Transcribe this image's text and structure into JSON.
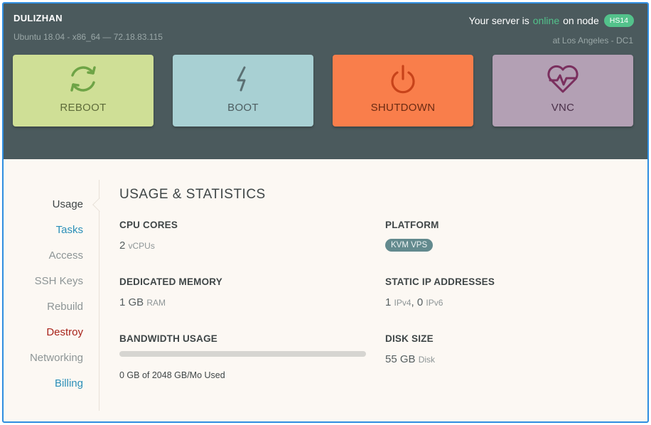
{
  "header": {
    "hostname": "DULIZHAN",
    "sysinfo": "Ubuntu 18.04 - x86_64 — 72.18.83.115",
    "status_prefix": "Your server is",
    "status_word": "online",
    "status_suffix": "on node",
    "node": "HS14",
    "location": "at Los Angeles - DC1"
  },
  "actions": {
    "reboot": {
      "label": "REBOOT",
      "icon": "refresh-icon",
      "color": "#cfdf96"
    },
    "boot": {
      "label": "BOOT",
      "icon": "lightning-icon",
      "color": "#a8d0d3"
    },
    "shutdown": {
      "label": "SHUTDOWN",
      "icon": "power-icon",
      "color": "#f97e4b"
    },
    "vnc": {
      "label": "VNC",
      "icon": "heartbeat-icon",
      "color": "#b3a0b4"
    }
  },
  "sidebar": {
    "items": [
      {
        "label": "Usage",
        "active": true
      },
      {
        "label": "Tasks"
      },
      {
        "label": "Access"
      },
      {
        "label": "SSH Keys"
      },
      {
        "label": "Rebuild"
      },
      {
        "label": "Destroy"
      },
      {
        "label": "Networking"
      },
      {
        "label": "Billing"
      }
    ]
  },
  "main": {
    "title": "USAGE & STATISTICS",
    "cpu": {
      "label": "CPU CORES",
      "value": "2",
      "unit": "vCPUs"
    },
    "platform": {
      "label": "PLATFORM",
      "badge": "KVM VPS"
    },
    "memory": {
      "label": "DEDICATED MEMORY",
      "value": "1 GB",
      "unit": "RAM"
    },
    "ips": {
      "label": "STATIC IP ADDRESSES",
      "v4_count": "1",
      "v4_unit": "IPv4",
      "v6_count": "0",
      "v6_unit": "IPv6"
    },
    "bandwidth": {
      "label": "BANDWIDTH USAGE",
      "used_fraction": 0,
      "text": "0 GB of 2048 GB/Mo Used"
    },
    "disk": {
      "label": "DISK SIZE",
      "value": "55 GB",
      "unit": "Disk"
    }
  },
  "colors": {
    "online": "#53c28b",
    "link": "#2b8fb8",
    "danger": "#a8231a",
    "muted": "#8d9596",
    "active": "#3f4647"
  }
}
